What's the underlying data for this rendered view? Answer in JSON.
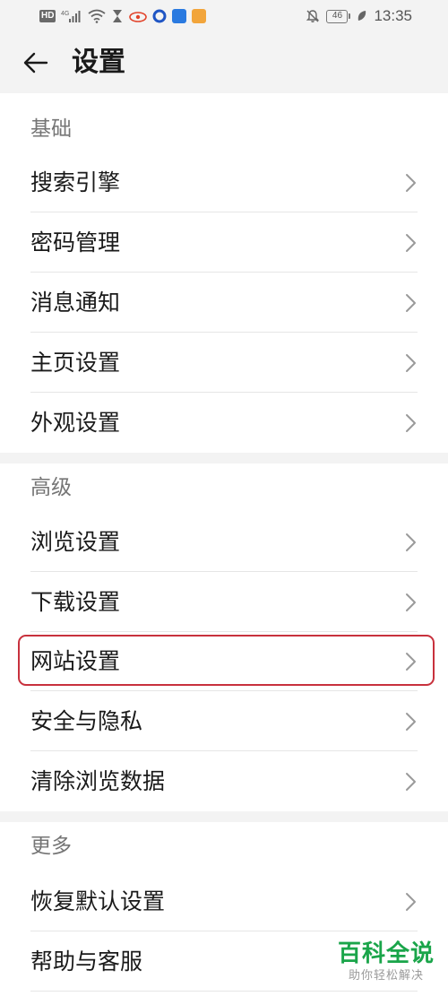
{
  "status_bar": {
    "hd_badge": "HD",
    "network_type": "4G",
    "battery_level": "46",
    "time": "13:35"
  },
  "header": {
    "title": "设置"
  },
  "sections": [
    {
      "header": "基础",
      "items": [
        {
          "label": "搜索引擎"
        },
        {
          "label": "密码管理"
        },
        {
          "label": "消息通知"
        },
        {
          "label": "主页设置"
        },
        {
          "label": "外观设置"
        }
      ]
    },
    {
      "header": "高级",
      "items": [
        {
          "label": "浏览设置"
        },
        {
          "label": "下载设置"
        },
        {
          "label": "网站设置"
        },
        {
          "label": "安全与隐私"
        },
        {
          "label": "清除浏览数据"
        }
      ]
    },
    {
      "header": "更多",
      "items": [
        {
          "label": "恢复默认设置"
        },
        {
          "label": "帮助与客服"
        }
      ]
    }
  ],
  "watermark": {
    "main": "百科全说",
    "sub": "助你轻松解决"
  },
  "colors": {
    "highlight_border": "#c8313d",
    "watermark_green": "#1aa54a",
    "header_bg": "#f3f3f3"
  }
}
